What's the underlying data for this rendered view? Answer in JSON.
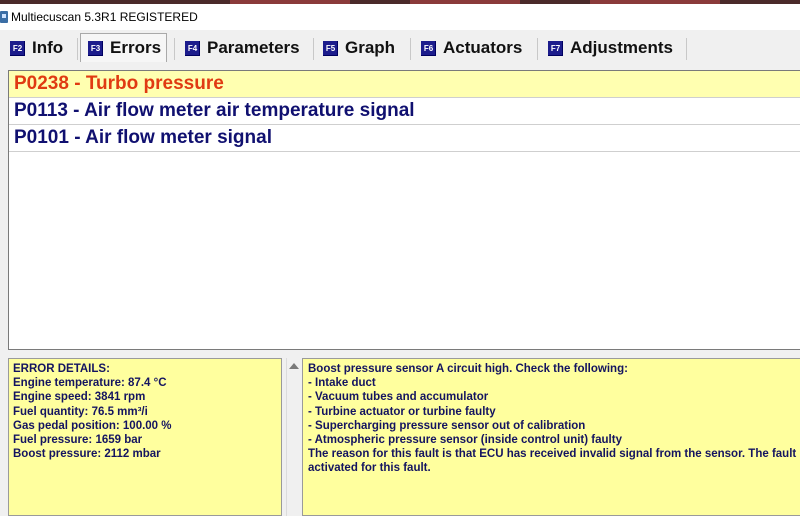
{
  "window": {
    "title": "Multiecuscan 5.3R1 REGISTERED"
  },
  "tabs": [
    {
      "key": "F2",
      "label": "Info"
    },
    {
      "key": "F3",
      "label": "Errors",
      "active": true
    },
    {
      "key": "F4",
      "label": "Parameters"
    },
    {
      "key": "F5",
      "label": "Graph"
    },
    {
      "key": "F6",
      "label": "Actuators"
    },
    {
      "key": "F7",
      "label": "Adjustments"
    }
  ],
  "errors": [
    {
      "text": "P0238 - Turbo pressure",
      "selected": true
    },
    {
      "text": "P0113 - Air flow meter air temperature signal"
    },
    {
      "text": "P0101 - Air flow meter signal"
    }
  ],
  "details": {
    "heading": "ERROR DETAILS:",
    "lines": [
      "Engine temperature: 87.4 °C",
      "Engine speed: 3841 rpm",
      "Fuel quantity: 76.5 mm³/i",
      "Gas pedal position: 100.00 %",
      "Fuel pressure: 1659 bar",
      "Boost pressure: 2112 mbar"
    ]
  },
  "description": {
    "lines": [
      "Boost pressure sensor A circuit high. Check the following:",
      "- Intake duct",
      "- Vacuum tubes and accumulator",
      "- Turbine actuator or turbine faulty",
      "- Supercharging pressure sensor out of calibration",
      "- Atmospheric pressure sensor (inside control unit) faulty",
      "The reason for this fault is that ECU has received invalid signal from the sensor. The fault",
      "activated for this fault."
    ]
  },
  "colors": {
    "selected_error": "#e03a12",
    "error_text": "#101070",
    "panel_bg": "#ffff9e",
    "fkey_bg": "#1c1c8c"
  }
}
